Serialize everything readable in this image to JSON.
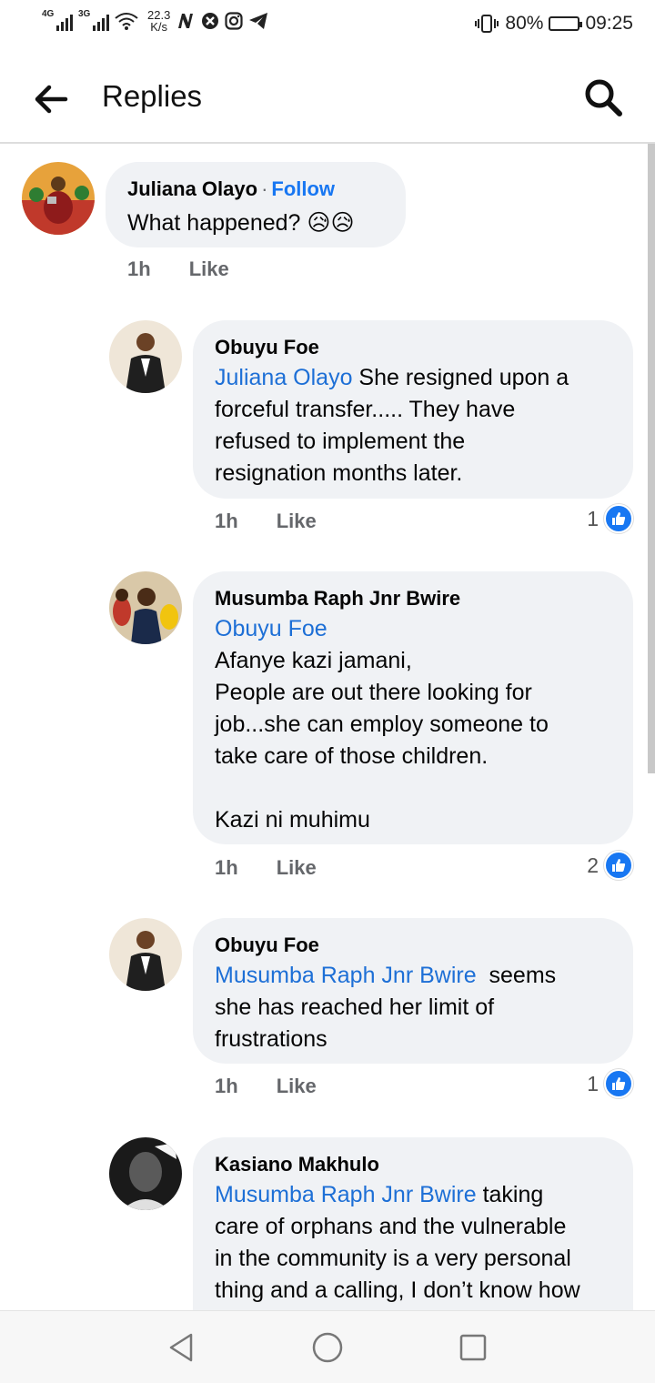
{
  "status_bar": {
    "network1": "4G",
    "network2": "3G",
    "speed_value": "22.3",
    "speed_unit": "K/s",
    "battery": "80%",
    "battery_level": 0.8,
    "time": "09:25"
  },
  "header": {
    "title": "Replies"
  },
  "comments": [
    {
      "author": "Juliana Olayo",
      "follow_label": "Follow",
      "mention": "",
      "text": "What happened? 😥😥",
      "time": "1h",
      "like_label": "Like",
      "reactions": ""
    },
    {
      "author": "Obuyu Foe",
      "mention": "Juliana Olayo",
      "text": " She resigned upon a\nforceful transfer..... They have\nrefused to implement the\nresignation months later.",
      "time": "1h",
      "like_label": "Like",
      "reactions": "1"
    },
    {
      "author": "Musumba Raph Jnr Bwire",
      "mention": "Obuyu Foe",
      "text": "\nAfanye kazi jamani,\nPeople are out there looking for\njob...she can employ someone to\ntake care of those children.\n\nKazi ni muhimu",
      "time": "1h",
      "like_label": "Like",
      "reactions": "2"
    },
    {
      "author": "Obuyu Foe",
      "mention": "Musumba Raph Jnr Bwire",
      "text": "  seems\nshe has reached her limit of\nfrustrations",
      "time": "1h",
      "like_label": "Like",
      "reactions": "1"
    },
    {
      "author": "Kasiano Makhulo",
      "mention": "Musumba Raph Jnr Bwire",
      "text": " taking\ncare of orphans and the vulnerable\nin the community is a very personal\nthing and a calling, I don’t know how",
      "time": "",
      "like_label": "",
      "reactions": ""
    }
  ],
  "colors": {
    "link_blue": "#1d6fd6",
    "bubble_bg": "#f0f2f5",
    "like_badge": "#1877f2",
    "meta_gray": "#65676b"
  }
}
